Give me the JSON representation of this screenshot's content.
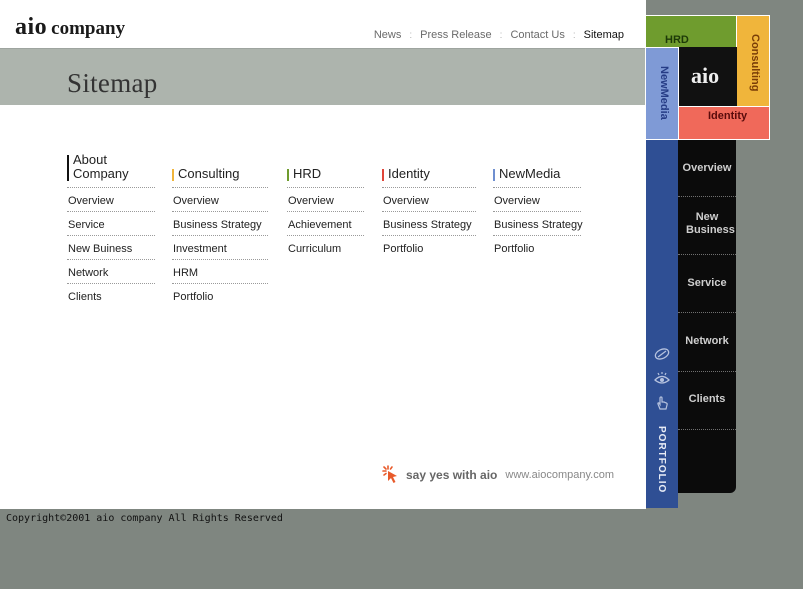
{
  "logo": {
    "aio": "aio",
    "company": "company"
  },
  "topnav": [
    {
      "label": "News"
    },
    {
      "label": "Press Release"
    },
    {
      "label": "Contact Us"
    },
    {
      "label": "Sitemap",
      "active": true
    }
  ],
  "page_title": "Sitemap",
  "columns": [
    {
      "heading": "About Company",
      "heading_line1": "About",
      "heading_line2": "Company",
      "color": "#111111",
      "items": [
        "Overview",
        "Service",
        "New Buiness",
        "Network",
        "Clients"
      ]
    },
    {
      "heading": "Consulting",
      "color": "#f0b53b",
      "items": [
        "Overview",
        "Business Strategy",
        "Investment",
        "HRM",
        "Portfolio"
      ]
    },
    {
      "heading": "HRD",
      "color": "#6f9c2e",
      "items": [
        "Overview",
        "Achievement",
        "Curriculum"
      ]
    },
    {
      "heading": "Identity",
      "color": "#e0463a",
      "items": [
        "Overview",
        "Business Strategy",
        "Portfolio"
      ]
    },
    {
      "heading": "NewMedia",
      "color": "#6f8fd0",
      "items": [
        "Overview",
        "Business Strategy",
        "Portfolio"
      ]
    }
  ],
  "slogan": {
    "text": "say yes with aio",
    "url": "www.aiocompany.com"
  },
  "footer": "Copyright©2001 aio company All Rights Reserved",
  "tiles": {
    "hrd": "HRD",
    "consulting": "Consulting",
    "aio": "aio",
    "newmedia": "NewMedia",
    "identity": "Identity"
  },
  "side_menu": [
    "Overview",
    "New Business",
    "Service",
    "Network",
    "Clients"
  ],
  "portfolio_label": "PORTFOLIO",
  "icons": [
    "link-icon",
    "eye-icon",
    "hand-pointer-icon",
    "cursor-burst-icon"
  ]
}
